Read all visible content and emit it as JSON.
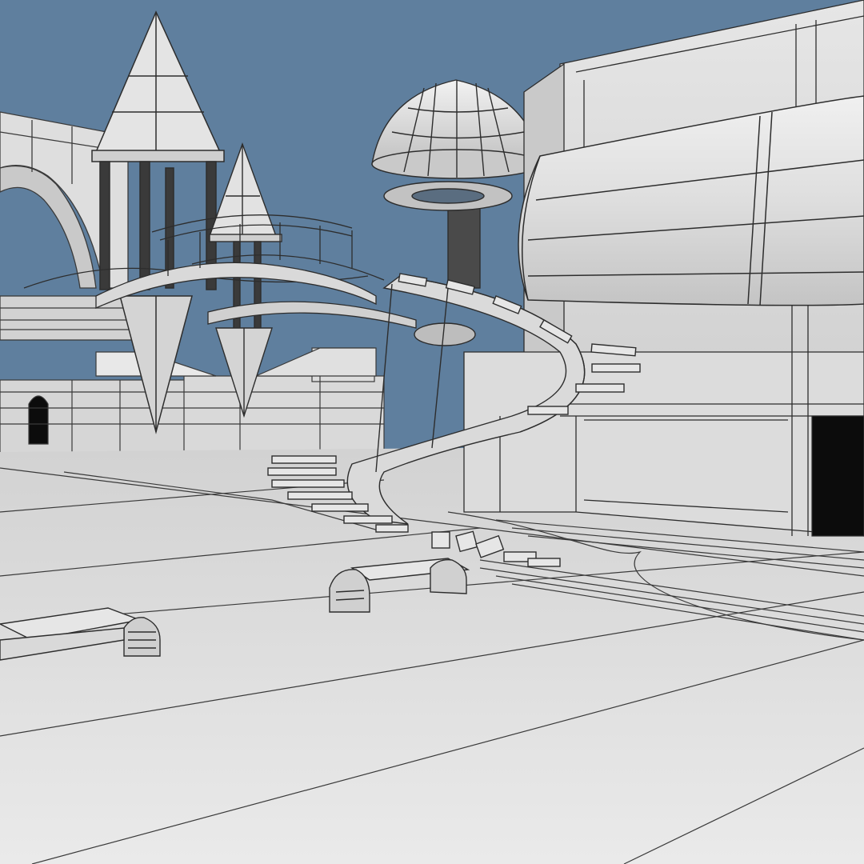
{
  "scene": {
    "colors": {
      "sky": "#5f7f9e",
      "ground": "#e3e3e3",
      "wall": "#dcdcdc",
      "wall_shadow": "#c8c8c8",
      "wire": "#3a3a3a",
      "doorway": "#0c0c0c"
    },
    "objects": [
      "left-arch-bridge",
      "tall-pyramid-tower",
      "small-pyramid-tower",
      "curved-walkway-bridges",
      "mushroom-dome-tower",
      "spiral-staircase",
      "right-building",
      "cylindrical-tube-section",
      "building-doorway",
      "back-low-buildings",
      "floor-grid",
      "bench-front-left",
      "bench-center"
    ]
  }
}
